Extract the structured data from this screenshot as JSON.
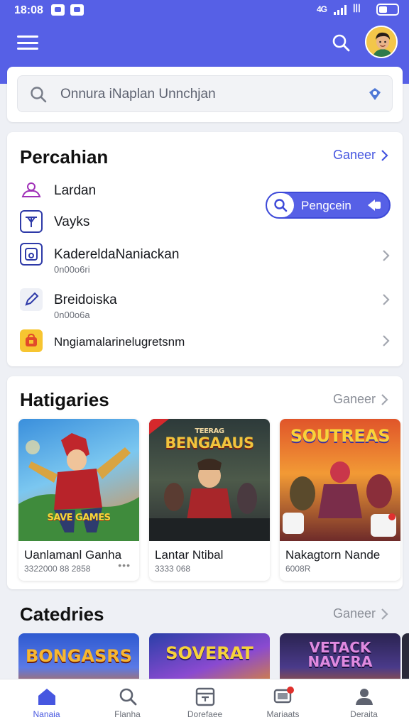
{
  "status_bar": {
    "time": "18:08",
    "signal_text": "4G",
    "network_text": "ꟾꟾꟾ"
  },
  "search": {
    "placeholder": "Onnura iNaplan Unnchjan"
  },
  "preferences": {
    "title": "Percahian",
    "see_all": "Ganeer",
    "action_button": "Pengcein",
    "items": [
      {
        "label": "Lardan",
        "icon": "user-outline-icon"
      },
      {
        "label": "Vayks",
        "icon": "tool-icon"
      },
      {
        "label": "KadereldaNaniackan",
        "sub": "0n00o6ri",
        "icon": "image-frame-icon"
      },
      {
        "label": "Breidoiska",
        "sub": "0n00o6a",
        "icon": "pencil-icon"
      },
      {
        "label": "Nngiamalarinelugretsnm",
        "icon": "lock-app-icon"
      }
    ]
  },
  "featured": {
    "title": "Hatigaries",
    "see_all": "Ganeer",
    "games": [
      {
        "name": "Uanlamanl Ganha",
        "meta": "3322000 88 2858",
        "art_text": "SAVE GAMES",
        "more": "•••"
      },
      {
        "name": "Lantar Ntibal",
        "meta": "3333 068",
        "art_text": "BENGAAUS",
        "art_top": "TEERAG"
      },
      {
        "name": "Nakagtorn Nande",
        "meta": "6008R",
        "art_text": "SOUTREAS"
      }
    ]
  },
  "categories": {
    "title": "Catedries",
    "see_all": "Ganeer",
    "cards": [
      {
        "art_text": "BONGASRS"
      },
      {
        "art_text": "SOVERAT"
      },
      {
        "art_text": "VETACK NAVERA"
      }
    ]
  },
  "bottom_nav": [
    {
      "label": "Nanaia",
      "icon": "home-icon",
      "active": true
    },
    {
      "label": "Flanha",
      "icon": "search-icon",
      "active": false
    },
    {
      "label": "Dorefaee",
      "icon": "calendar-icon",
      "active": false
    },
    {
      "label": "Mariaats",
      "icon": "message-icon",
      "active": false
    },
    {
      "label": "Deraita",
      "icon": "profile-icon",
      "active": false
    }
  ],
  "colors": {
    "accent": "#5660e6",
    "accent_dark": "#3d49d8",
    "background": "#eef0f5"
  }
}
